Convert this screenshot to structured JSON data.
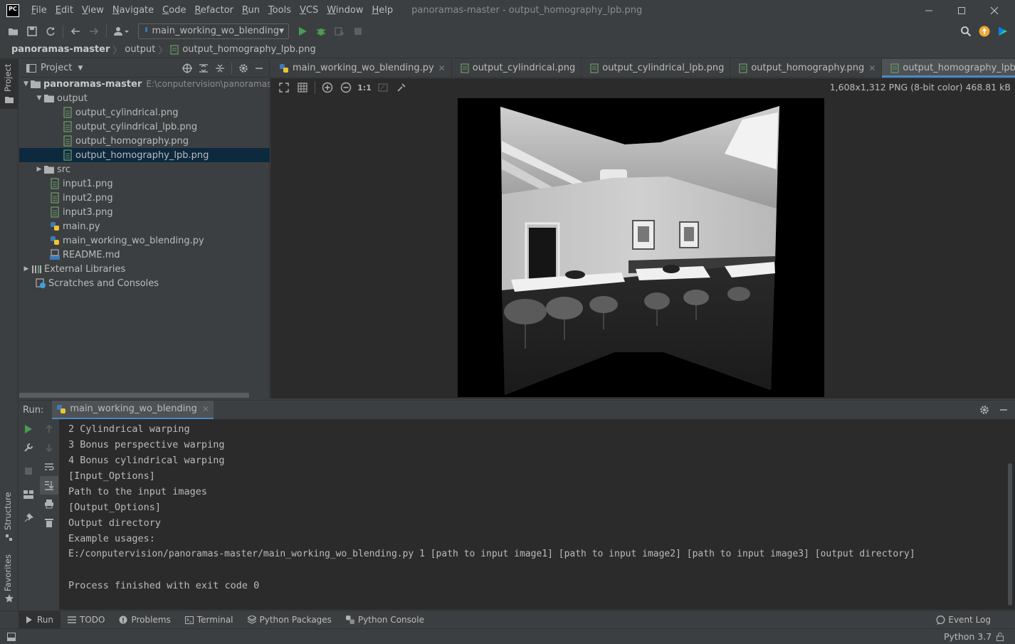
{
  "titlebar": {
    "logo": "PC",
    "menu": [
      {
        "label": "File",
        "mn": "F",
        "rest": "ile"
      },
      {
        "label": "Edit",
        "mn": "E",
        "rest": "dit"
      },
      {
        "label": "View",
        "mn": "V",
        "rest": "iew"
      },
      {
        "label": "Navigate",
        "mn": "N",
        "rest": "avigate"
      },
      {
        "label": "Code",
        "mn": "C",
        "rest": "ode"
      },
      {
        "label": "Refactor",
        "mn": "R",
        "rest": "efactor"
      },
      {
        "label": "Run",
        "mn": "R",
        "rest": "un"
      },
      {
        "label": "Tools",
        "mn": "T",
        "rest": "ools"
      },
      {
        "label": "VCS",
        "mn": "V",
        "rest": "CS"
      },
      {
        "label": "Window",
        "mn": "W",
        "rest": "indow"
      },
      {
        "label": "Help",
        "mn": "H",
        "rest": "elp"
      }
    ],
    "window_title": "panoramas-master - output_homography_lpb.png"
  },
  "toolbar": {
    "run_config": "main_working_wo_blending"
  },
  "breadcrumb": [
    "panoramas-master",
    "output",
    "output_homography_lpb.png"
  ],
  "left_stripe": {
    "project": "Project",
    "structure": "Structure",
    "favorites": "Favorites"
  },
  "project": {
    "title": "Project",
    "root_name": "panoramas-master",
    "root_path": "E:\\conputervision\\panoramas-master",
    "tree": [
      {
        "label": "output"
      },
      {
        "label": "output_cylindrical.png"
      },
      {
        "label": "output_cylindrical_lpb.png"
      },
      {
        "label": "output_homography.png"
      },
      {
        "label": "output_homography_lpb.png"
      },
      {
        "label": "src"
      },
      {
        "label": "input1.png"
      },
      {
        "label": "input2.png"
      },
      {
        "label": "input3.png"
      },
      {
        "label": "main.py"
      },
      {
        "label": "main_working_wo_blending.py"
      },
      {
        "label": "README.md"
      },
      {
        "label": "External Libraries"
      },
      {
        "label": "Scratches and Consoles"
      }
    ]
  },
  "editor": {
    "tabs": [
      {
        "label": "main_working_wo_blending.py"
      },
      {
        "label": "output_cylindrical.png"
      },
      {
        "label": "output_cylindrical_lpb.png"
      },
      {
        "label": "output_homography.png"
      },
      {
        "label": "output_homography_lpb.png"
      }
    ],
    "image_info": "1,608x1,312 PNG (8-bit color) 468.81 kB",
    "zoom_actual": "1:1"
  },
  "run": {
    "label": "Run:",
    "tab": "main_working_wo_blending",
    "console": [
      "2 Cylindrical warping",
      "3 Bonus perspective warping",
      "4 Bonus cylindrical warping",
      "[Input_Options]",
      "Path to the input images",
      "[Output_Options]",
      "Output directory",
      "Example usages:",
      "E:/conputervision/panoramas-master/main_working_wo_blending.py 1 [path to input image1] [path to input image2] [path to input image3] [output directory]",
      "",
      "Process finished with exit code 0"
    ]
  },
  "bottom_bar": {
    "items": [
      "Run",
      "TODO",
      "Problems",
      "Terminal",
      "Python Packages",
      "Python Console"
    ],
    "event_log": "Event Log"
  },
  "status": {
    "interpreter": "Python 3.7"
  },
  "colors": {
    "bg": "#3c3f41",
    "editor_bg": "#2b2b2b",
    "accent": "#4a88c7",
    "selection": "#0d293e",
    "run_green": "#499c54",
    "update_orange": "#f0a732"
  }
}
